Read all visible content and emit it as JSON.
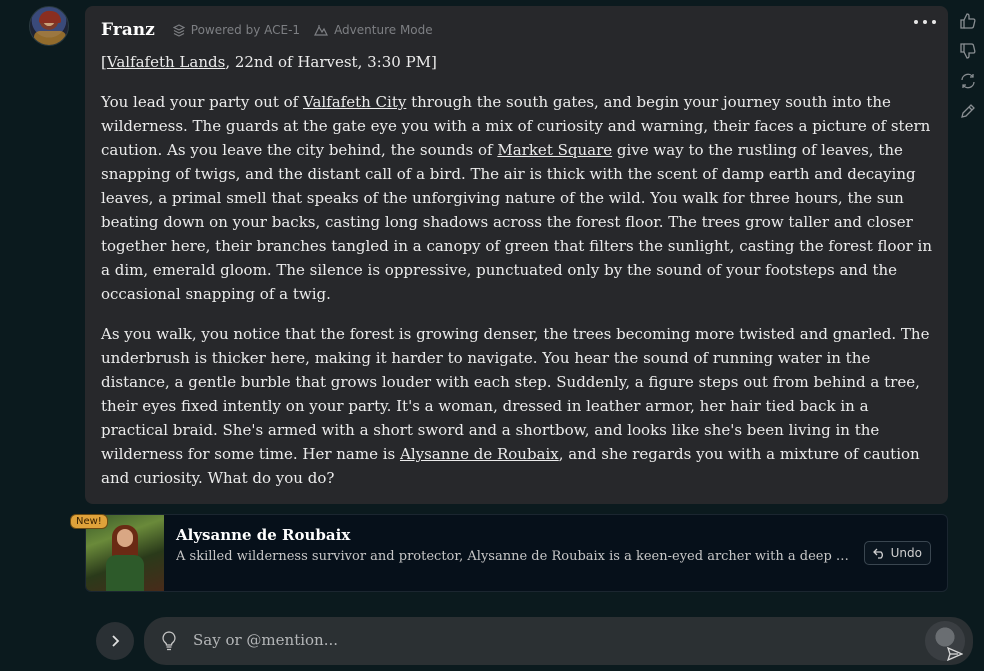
{
  "message": {
    "speaker": "Franz",
    "powered_by": "Powered by ACE-1",
    "mode": "Adventure Mode",
    "location_link": "Valfafeth Lands",
    "location_rest": ", 22nd of Harvest, 3:30 PM]",
    "location_open": "[",
    "p1_a": "You lead your party out of ",
    "p1_link1": "Valfafeth City",
    "p1_b": " through the south gates, and begin your journey south into the wilderness. The guards at the gate eye you with a mix of curiosity and warning, their faces a picture of stern caution. As you leave the city behind, the sounds of ",
    "p1_link2": "Market Square",
    "p1_c": " give way to the rustling of leaves, the snapping of twigs, and the distant call of a bird. The air is thick with the scent of damp earth and decaying leaves, a primal smell that speaks of the unforgiving nature of the wild. You walk for three hours, the sun beating down on your backs, casting long shadows across the forest floor. The trees grow taller and closer together here, their branches tangled in a canopy of green that filters the sunlight, casting the forest floor in a dim, emerald gloom. The silence is oppressive, punctuated only by the sound of your footsteps and the occasional snapping of a twig.",
    "p2_a": "As you walk, you notice that the forest is growing denser, the trees becoming more twisted and gnarled. The underbrush is thicker here, making it harder to navigate. You hear the sound of running water in the distance, a gentle burble that grows louder with each step. Suddenly, a figure steps out from behind a tree, their eyes fixed intently on your party. It's a woman, dressed in leather armor, her hair tied back in a practical braid. She's armed with a short sword and a shortbow, and looks like she's been living in the wilderness for some time. Her name is ",
    "p2_link": "Alysanne de Roubaix",
    "p2_b": ", and she regards you with a mixture of caution and curiosity. What do you do?"
  },
  "new_character": {
    "badge": "New!",
    "name": "Alysanne de Roubaix",
    "description": "A skilled wilderness survivor and protector, Alysanne de Roubaix is a keen-eyed archer with a deep connection to the forest.",
    "undo_label": "Undo"
  },
  "composer": {
    "placeholder": "Say or @mention..."
  },
  "icons": {
    "like": "thumbs-up-icon",
    "dislike": "thumbs-down-icon",
    "regenerate": "refresh-icon",
    "edit": "pencil-icon",
    "menu": "more-icon"
  }
}
